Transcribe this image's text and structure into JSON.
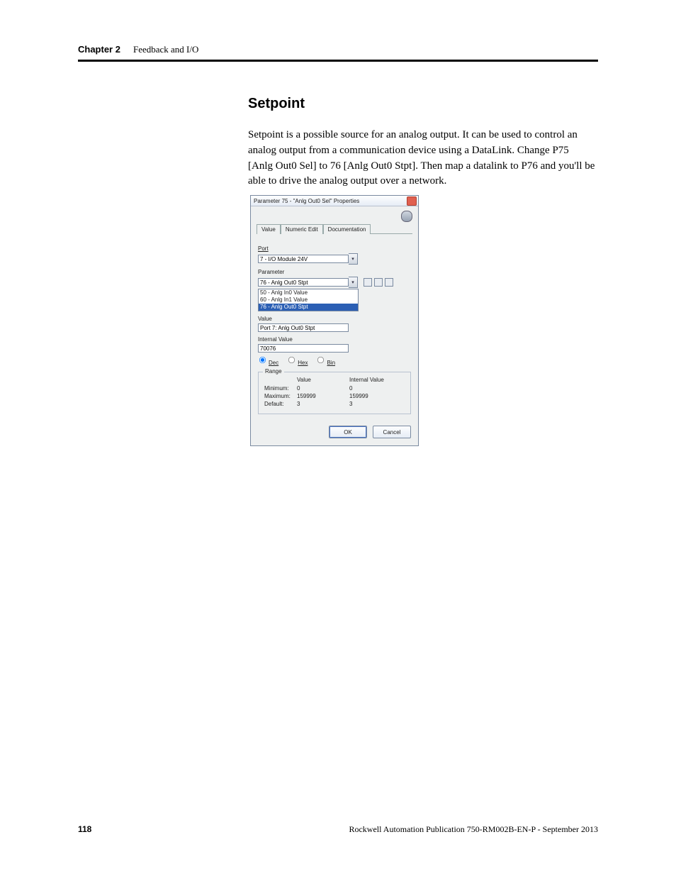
{
  "header": {
    "chapter": "Chapter 2",
    "section": "Feedback and I/O"
  },
  "content": {
    "heading": "Setpoint",
    "paragraph": "Setpoint is a possible source for an analog output. It can be used to control an analog output from a communication device using a DataLink. Change P75 [Anlg Out0 Sel] to 76 [Anlg Out0 Stpt]. Then map a datalink to P76 and you'll be able to drive the analog output over a network."
  },
  "dialog": {
    "title": "Parameter 75 - \"Anlg Out0 Sel\" Properties",
    "tabs": {
      "t1": "Value",
      "t2": "Numeric Edit",
      "t3": "Documentation"
    },
    "port_label": "Port",
    "port_value": "7 - I/O Module 24V",
    "parameter_label": "Parameter",
    "parameter_value": "76 - Anlg Out0 Stpt",
    "param_list": {
      "i0": "50 - Anlg In0 Value",
      "i1": "60 - Anlg In1 Value",
      "i2": "76 - Anlg Out0 Stpt"
    },
    "value_label": "Value",
    "value_text": "Port 7: Anlg Out0 Stpt",
    "internal_label": "Internal Value",
    "internal_text": "70076",
    "radios": {
      "dec": "Dec",
      "hex": "Hex",
      "bin": "Bin"
    },
    "range": {
      "legend": "Range",
      "hdr_value": "Value",
      "hdr_internal": "Internal Value",
      "min_label": "Minimum:",
      "min_value": "0",
      "min_internal": "0",
      "max_label": "Maximum:",
      "max_value": "159999",
      "max_internal": "159999",
      "def_label": "Default:",
      "def_value": "3",
      "def_internal": "3"
    },
    "buttons": {
      "ok": "OK",
      "cancel": "Cancel"
    }
  },
  "footer": {
    "page": "118",
    "publication": "Rockwell Automation Publication 750-RM002B-EN-P - September 2013"
  }
}
